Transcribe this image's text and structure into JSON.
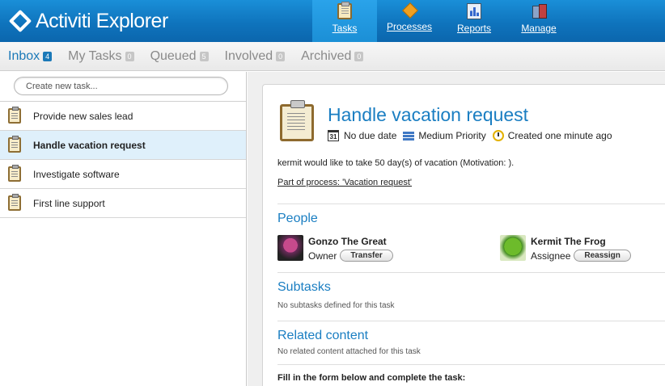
{
  "app": {
    "title": "Activiti Explorer"
  },
  "nav": {
    "items": [
      {
        "label": "Tasks",
        "icon": "tasks-icon",
        "active": true
      },
      {
        "label": "Processes",
        "icon": "processes-icon"
      },
      {
        "label": "Reports",
        "icon": "reports-icon"
      },
      {
        "label": "Manage",
        "icon": "manage-icon"
      }
    ]
  },
  "tabs": [
    {
      "label": "Inbox",
      "count": "4",
      "active": true
    },
    {
      "label": "My Tasks",
      "count": "0"
    },
    {
      "label": "Queued",
      "count": "5"
    },
    {
      "label": "Involved",
      "count": "0"
    },
    {
      "label": "Archived",
      "count": "0"
    }
  ],
  "sidebar": {
    "new_task_placeholder": "Create new task...",
    "tasks": [
      {
        "name": "Provide new sales lead"
      },
      {
        "name": "Handle vacation request",
        "selected": true
      },
      {
        "name": "Investigate software"
      },
      {
        "name": "First line support"
      }
    ]
  },
  "task": {
    "title": "Handle vacation request",
    "due": "No due date",
    "priority": "Medium Priority",
    "created": "Created one minute ago",
    "calendar_day": "31",
    "description": "kermit would like to take 50 day(s) of vacation (Motivation: ).",
    "process_link": "Part of process: 'Vacation request'"
  },
  "people": {
    "title": "People",
    "owner": {
      "name": "Gonzo The Great",
      "role": "Owner",
      "action": "Transfer"
    },
    "assignee": {
      "name": "Kermit The Frog",
      "role": "Assignee",
      "action": "Reassign"
    }
  },
  "subtasks": {
    "title": "Subtasks",
    "empty": "No subtasks defined for this task"
  },
  "related": {
    "title": "Related content",
    "empty": "No related content attached for this task"
  },
  "form": {
    "prompt": "Fill in the form below and complete the task:"
  },
  "colors": {
    "brand": "#0f74bd",
    "accent": "#1a7ec2",
    "selected_row": "#dff0fb"
  }
}
